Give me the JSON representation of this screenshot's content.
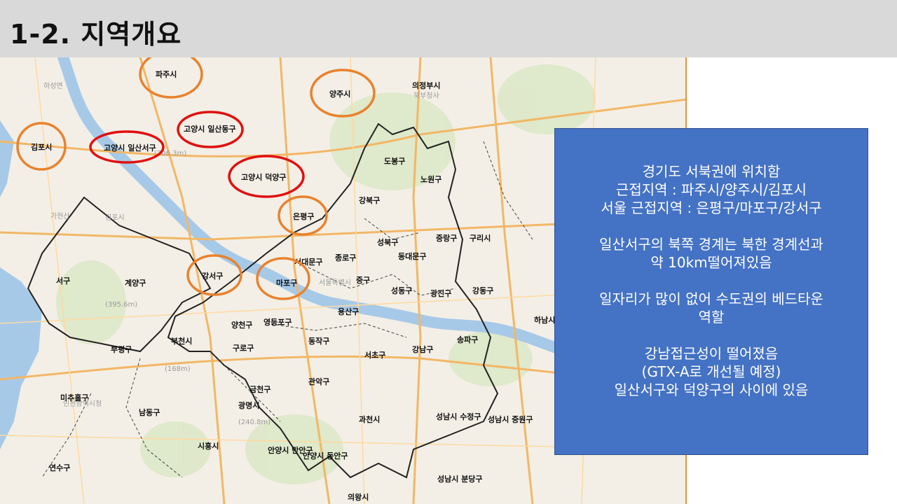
{
  "title": "1-2. 지역개요",
  "info_lines": [
    "경기도 서북권에 위치함",
    "근접지역 : 파주시/양주시/김포시",
    "서울 근접지역 : 은평구/마포구/강서구",
    "",
    "일산서구의 북쪽 경계는 북한 경계선과",
    "약 10km떨어져있음",
    "",
    "일자리가 많이 없어 수도권의 베드타운",
    "역할",
    "",
    "강남접근성이 떨어졌음",
    "(GTX-A로 개선될 예정)",
    "일산서구와 덕양구의 사이에 있음"
  ],
  "map": {
    "orange_circles": [
      "파주시",
      "양주시",
      "김포시",
      "은평구",
      "강서구",
      "마포구"
    ],
    "red_circles": [
      "고양시 일산동구",
      "고양시 일산서구",
      "고양시 덕양구"
    ],
    "district_labels": [
      "의정부시",
      "도봉구",
      "노원구",
      "강북구",
      "성북구",
      "중랑구",
      "구리시",
      "서대문구",
      "종로구",
      "동대문구",
      "중구",
      "성동구",
      "광진구",
      "강동구",
      "하남시",
      "용산구",
      "영등포구",
      "양천구",
      "구로구",
      "동작구",
      "서초구",
      "강남구",
      "송파구",
      "계양구",
      "부평구",
      "부천시",
      "금천구",
      "관악구",
      "광명시",
      "남동구",
      "미추홀구",
      "연수구",
      "시흥시",
      "과천시",
      "안양시 만안구",
      "안양시 동안구",
      "성남시 수정구",
      "성남시 중원구",
      "성남시 분당구",
      "의왕시",
      "서구"
    ],
    "muted_labels": [
      "하성면",
      "북부청사",
      "김포시",
      "가현산",
      "(395.6m)",
      "(168m)",
      "(240.8m)",
      "인천광역시청",
      "서울특별시",
      "(206.3m)"
    ]
  }
}
